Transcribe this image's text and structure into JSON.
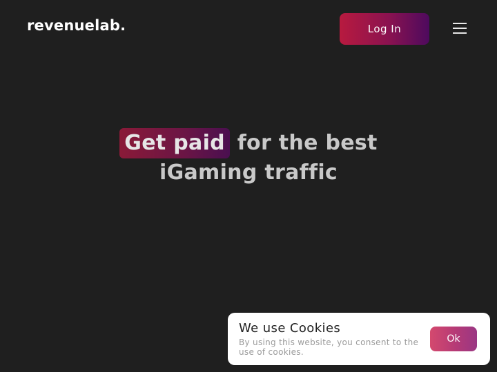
{
  "header": {
    "logo_text": "revenuelab.",
    "login_label": "Log In",
    "menu_icon": "hamburger-menu-icon"
  },
  "hero": {
    "highlight": "Get paid",
    "line1_rest": "for the best",
    "line2": "iGaming traffic"
  },
  "cookie_banner": {
    "title": "We use Cookies",
    "text": "By using this website, you consent to the use of cookies.",
    "ok_label": "Ok"
  },
  "colors": {
    "background": "#1f1f1f",
    "accent_start": "#b81a3f",
    "accent_end": "#4d0a5e"
  }
}
